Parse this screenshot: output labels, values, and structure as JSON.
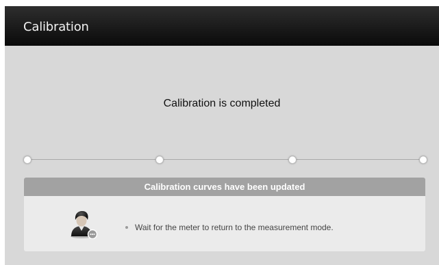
{
  "titlebar": {
    "title": "Calibration"
  },
  "status": {
    "message": "Calibration is completed"
  },
  "progress": {
    "steps_total": 4,
    "steps_completed": 4
  },
  "panel": {
    "header": "Calibration curves have been updated",
    "instruction": "Wait for the meter to return to the measurement mode.",
    "icon": "user-chat-icon"
  },
  "colors": {
    "titlebar": "#111111",
    "background": "#d8d8d8",
    "panel_header": "#a2a2a2",
    "panel_body": "#ebebeb"
  }
}
